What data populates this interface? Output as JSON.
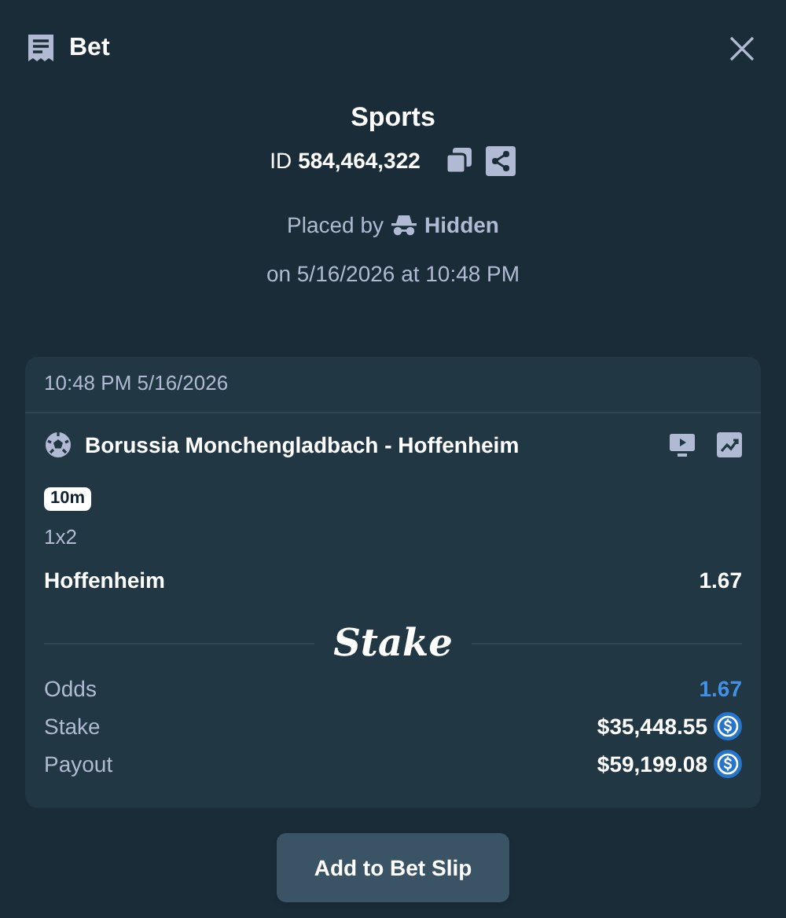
{
  "header": {
    "title": "Bet"
  },
  "title": "Sports",
  "bet_id": {
    "label": "ID",
    "value": "584,464,322"
  },
  "placed_by": {
    "label": "Placed by",
    "user": "Hidden"
  },
  "placed_on": "on 5/16/2026 at 10:48 PM",
  "card": {
    "timestamp": "10:48 PM 5/16/2026",
    "event": "Borussia Monchengladbach - Hoffenheim",
    "badge": "10m",
    "market": "1x2",
    "selection": "Hoffenheim",
    "selection_odds": "1.67",
    "logo": "Stake",
    "summary": [
      {
        "label": "Odds",
        "value": "1.67",
        "kind": "odds"
      },
      {
        "label": "Stake",
        "value": "$35,448.55",
        "kind": "currency"
      },
      {
        "label": "Payout",
        "value": "$59,199.08",
        "kind": "currency"
      }
    ]
  },
  "button": "Add to Bet Slip"
}
